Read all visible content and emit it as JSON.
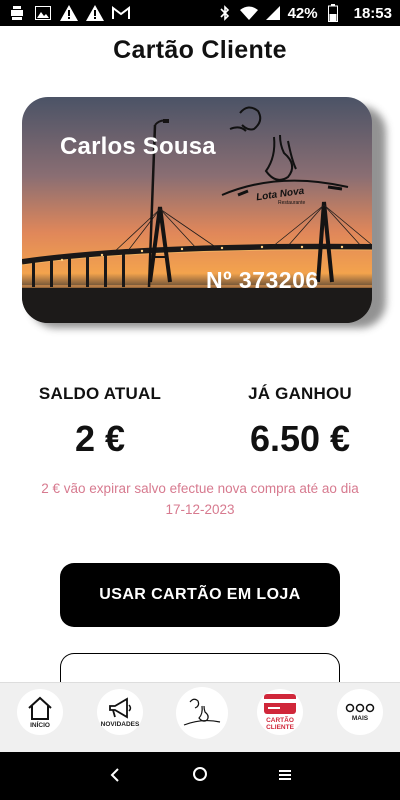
{
  "status_bar": {
    "battery_pct": "42%",
    "time": "18:53",
    "left_icons": [
      "notification-icon",
      "image-icon",
      "warning-icon",
      "warning-icon",
      "gmail-icon"
    ],
    "right_icons": [
      "bluetooth-icon",
      "wifi-icon",
      "signal-icon",
      "battery-icon"
    ]
  },
  "header": {
    "title": "Cartão Cliente"
  },
  "card": {
    "holder_name": "Carlos Sousa",
    "number": "Nº 373206",
    "logo_text": "Lota Nova",
    "logo_subtext": "Restaurante"
  },
  "balances": {
    "current_label": "SALDO ATUAL",
    "current_value": "2 €",
    "earned_label": "JÁ GANHOU",
    "earned_value": "6.50 €"
  },
  "expiry": {
    "line1": "2 € vão expirar salvo efectue nova compra até ao dia",
    "line2": "17-12-2023",
    "color": "#d77a8f"
  },
  "actions": {
    "use_card_label": "USAR CARTÃO EM LOJA"
  },
  "bottom_nav": {
    "items": [
      {
        "label": "INÍCIO",
        "icon": "home-icon"
      },
      {
        "label": "NOVIDADES",
        "icon": "megaphone-icon"
      },
      {
        "label": "",
        "icon": "lota-nova-logo-icon"
      },
      {
        "label": "CARTÃO CLIENTE",
        "icon": "card-icon",
        "active": true
      },
      {
        "label": "MAIS",
        "icon": "more-icon"
      }
    ],
    "active_color": "#d0273a"
  },
  "system_nav": {
    "icons": [
      "back-icon",
      "home-circle-icon",
      "recents-icon"
    ]
  }
}
